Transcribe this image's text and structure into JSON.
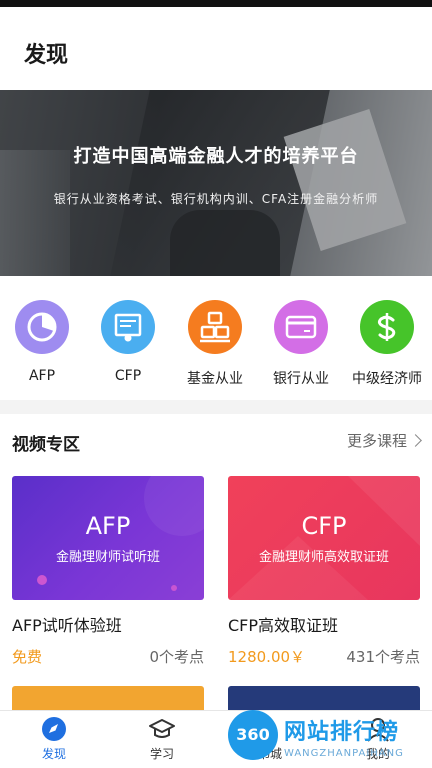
{
  "header": {
    "title": "发现"
  },
  "banner": {
    "title": "打造中国高端金融人才的培养平台",
    "subtitle": "银行从业资格考试、银行机构内训、CFA注册金融分析师"
  },
  "categories": [
    {
      "label": "AFP",
      "icon": "pie-chart-icon",
      "color": "#9e8cf0"
    },
    {
      "label": "CFP",
      "icon": "certificate-icon",
      "color": "#4aaef0"
    },
    {
      "label": "基金从业",
      "icon": "coins-stack-icon",
      "color": "#f57c1f"
    },
    {
      "label": "银行从业",
      "icon": "bank-card-icon",
      "color": "#d36ee6"
    },
    {
      "label": "中级经济师",
      "icon": "dollar-icon",
      "color": "#46c42a"
    }
  ],
  "section": {
    "title": "视频专区",
    "more": "更多课程"
  },
  "courses": [
    {
      "image_title": "AFP",
      "image_subtitle": "金融理财师试听班",
      "name": "AFP试听体验班",
      "price": "免费",
      "count": "0个考点",
      "color_from": "#5a2fc9",
      "color_to": "#8a3fd6"
    },
    {
      "image_title": "CFP",
      "image_subtitle": "金融理财师高效取证班",
      "name": "CFP高效取证班",
      "price": "1280.00￥",
      "count": "431个考点",
      "color_from": "#f0415a",
      "color_to": "#e8365e"
    }
  ],
  "tabs": [
    {
      "label": "发现",
      "icon": "compass-icon",
      "active": true
    },
    {
      "label": "学习",
      "icon": "graduation-cap-icon",
      "active": false
    },
    {
      "label": "书城",
      "icon": "book-icon",
      "active": false
    },
    {
      "label": "我的",
      "icon": "user-icon",
      "active": false
    }
  ],
  "watermark": {
    "logo_text": "360",
    "text": "网站排行榜",
    "url": "WANGZHANPAIHANG"
  },
  "colors": {
    "accent": "#1f6fe0",
    "price": "#f29a1d"
  }
}
